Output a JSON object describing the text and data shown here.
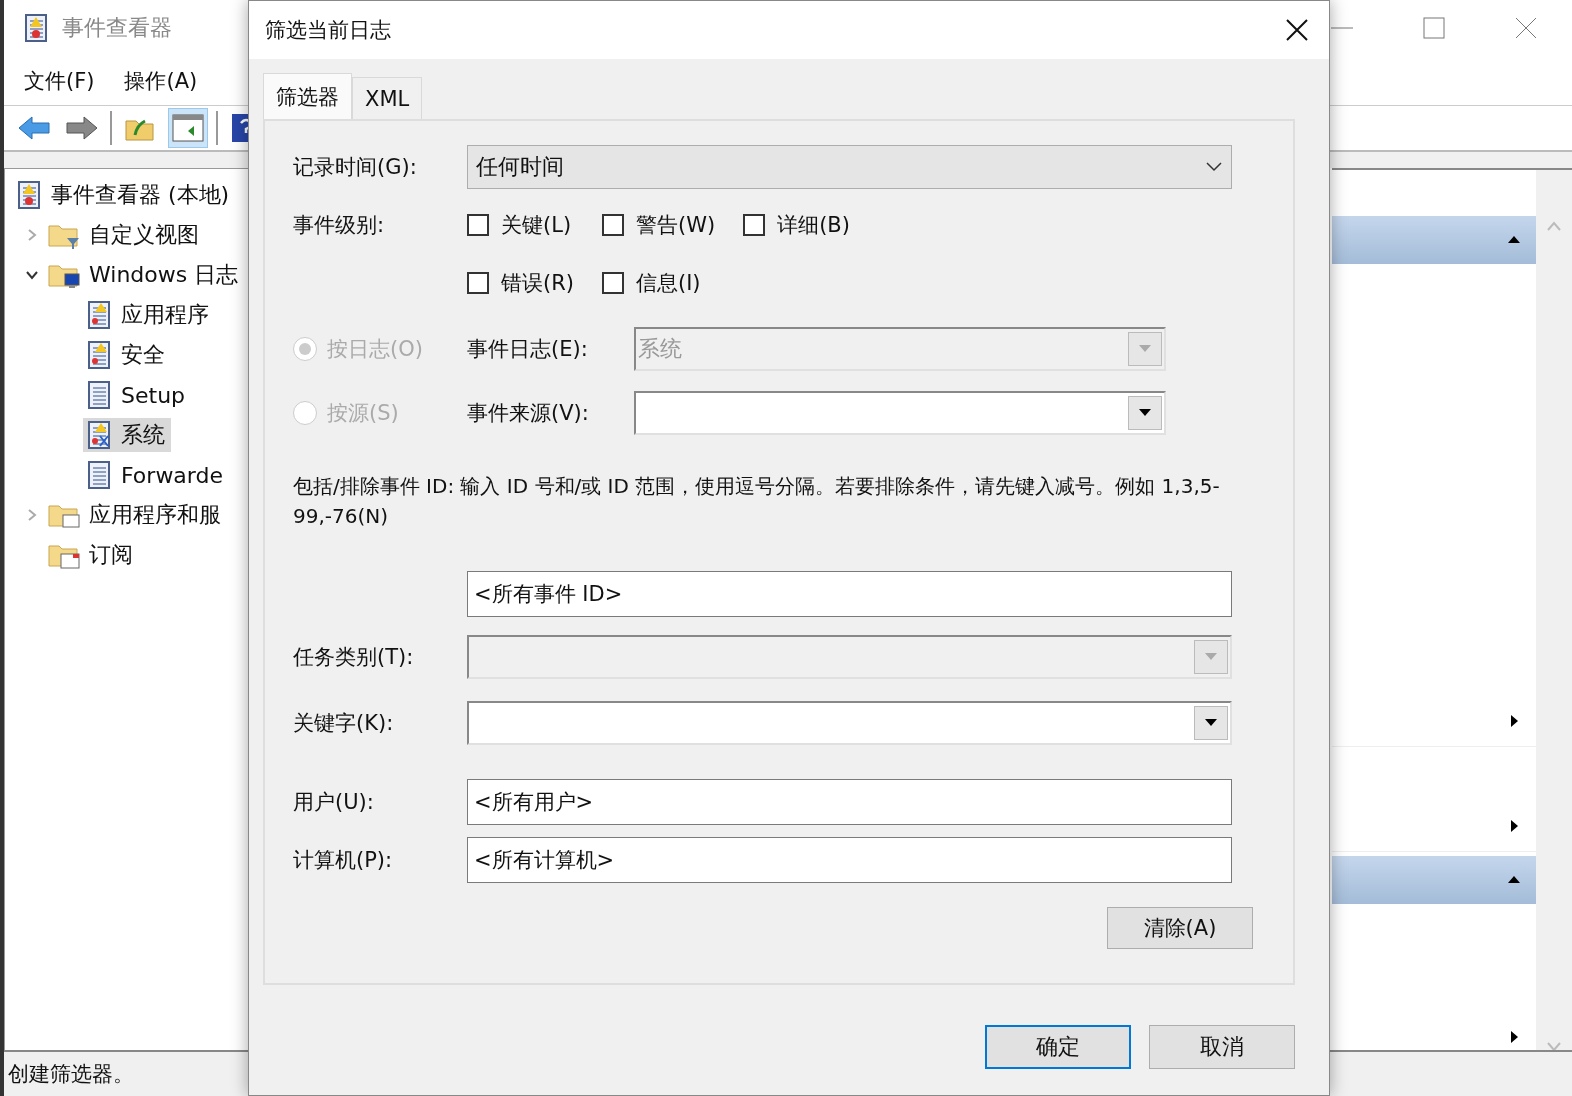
{
  "window": {
    "title": "事件查看器"
  },
  "menu": [
    {
      "label": "文件(F)"
    },
    {
      "label": "操作(A)"
    }
  ],
  "tree": [
    {
      "label": "事件查看器 (本地)",
      "kind": "viewer",
      "selected": false,
      "children": [
        {
          "label": "自定义视图",
          "kind": "folder-filter",
          "selected": false,
          "expanded": false
        },
        {
          "label": "Windows 日志",
          "kind": "folder-monitor",
          "selected": false,
          "expanded": true,
          "children": [
            {
              "label": "应用程序",
              "kind": "log-warning",
              "selected": false
            },
            {
              "label": "安全",
              "kind": "log-warning",
              "selected": false
            },
            {
              "label": "Setup",
              "kind": "log",
              "selected": false
            },
            {
              "label": "系统",
              "kind": "log-system",
              "selected": true
            },
            {
              "label": "Forwarde",
              "kind": "log",
              "selected": false
            }
          ]
        },
        {
          "label": "应用程序和服",
          "kind": "folder-window",
          "selected": false,
          "expanded": false
        },
        {
          "label": "订阅",
          "kind": "folder-calendar",
          "selected": false
        }
      ]
    }
  ],
  "status_bar": "创建筛选器。",
  "actions": [
    {
      "kind": "header"
    },
    {
      "kind": "gap"
    },
    {
      "kind": "gap"
    },
    {
      "kind": "gap"
    },
    {
      "kind": "gap"
    },
    {
      "kind": "gap"
    },
    {
      "kind": "gap"
    },
    {
      "kind": "gap"
    },
    {
      "kind": "gap"
    },
    {
      "kind": "item"
    },
    {
      "kind": "gap"
    },
    {
      "kind": "item"
    },
    {
      "kind": "header"
    },
    {
      "kind": "gap"
    },
    {
      "kind": "gap"
    },
    {
      "kind": "item"
    }
  ],
  "dialog": {
    "title": "筛选当前日志",
    "tabs": [
      {
        "label": "筛选器",
        "selected": true
      },
      {
        "label": "XML",
        "selected": false
      }
    ],
    "logged": {
      "label": "记录时间(G):",
      "value": "任何时间"
    },
    "levels": {
      "label": "事件级别:",
      "items": [
        {
          "label": "关键(L)",
          "checked": false
        },
        {
          "label": "警告(W)",
          "checked": false
        },
        {
          "label": "详细(B)",
          "checked": false
        },
        {
          "label": "错误(R)",
          "checked": false
        },
        {
          "label": "信息(I)",
          "checked": false
        }
      ]
    },
    "sources": [
      {
        "radio": "按日志(O)",
        "selected": true,
        "disabled": true,
        "label": "事件日志(E):",
        "value": "系统",
        "field_disabled": true
      },
      {
        "radio": "按源(S)",
        "selected": false,
        "disabled": true,
        "label": "事件来源(V):",
        "field_disabled": false
      }
    ],
    "description": "包括/排除事件 ID: 输入 ID 号和/或 ID 范围，使用逗号分隔。若要排除条件，请先键入减号。例如 1,3,5-99,-76(N)",
    "event_id": {
      "value": "<所有事件 ID>"
    },
    "task_category": {
      "label": "任务类别(T):",
      "disabled": true
    },
    "keywords": {
      "label": "关键字(K):",
      "disabled": false
    },
    "user": {
      "label": "用户(U):",
      "value": "<所有用户>"
    },
    "computer": {
      "label": "计算机(P):",
      "value": "<所有计算机>"
    },
    "clear_button": "清除(A)",
    "buttons": [
      {
        "label": "确定",
        "default": true
      },
      {
        "label": "取消",
        "default": false
      }
    ]
  }
}
